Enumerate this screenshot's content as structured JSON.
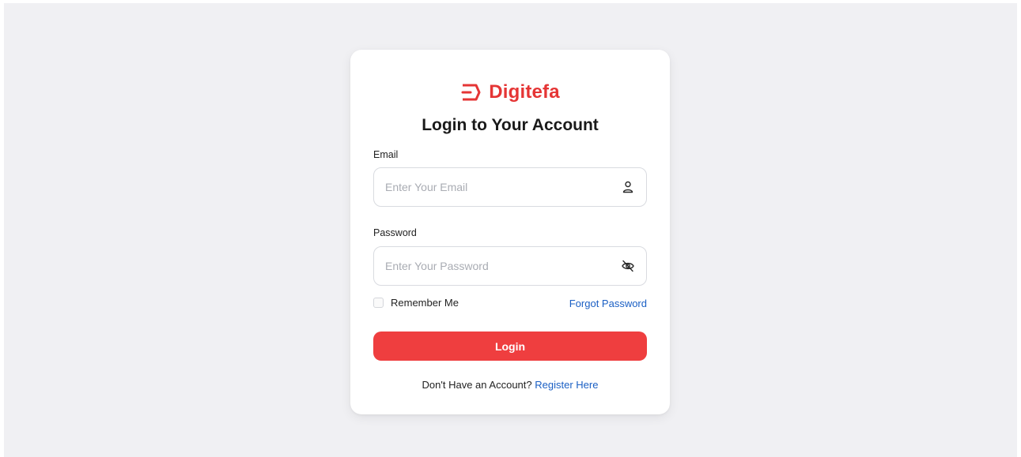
{
  "brand": {
    "name": "Digitefa",
    "color": "#e53535",
    "logo_icon": "brand-logo-icon"
  },
  "form": {
    "title": "Login to Your Account",
    "email": {
      "label": "Email",
      "value": "",
      "placeholder": "Enter Your Email",
      "icon": "user-icon"
    },
    "password": {
      "label": "Password",
      "value": "",
      "placeholder": "Enter Your Password",
      "icon": "eye-off-icon"
    },
    "remember_me": {
      "label": "Remember Me",
      "checked": false
    },
    "forgot_password_label": "Forgot Password",
    "login_button_label": "Login",
    "register_prompt": "Don't Have an Account?",
    "register_link_label": "Register Here"
  },
  "colors": {
    "accent": "#ef3e3f",
    "link": "#1a5fc4",
    "background": "#f0f0f3"
  }
}
